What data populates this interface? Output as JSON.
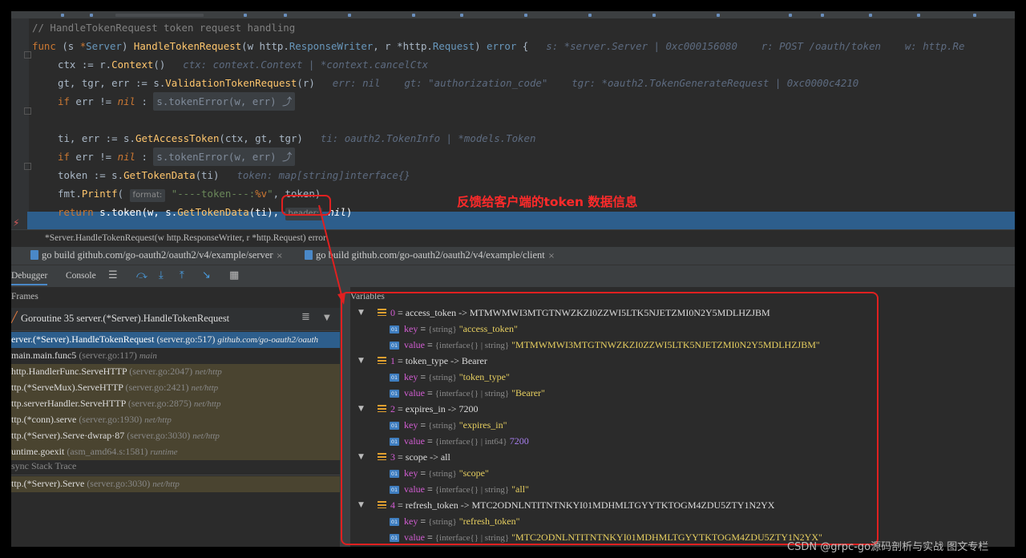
{
  "code": {
    "comment": "// HandleTokenRequest token request handling",
    "func_kw": "func",
    "func_recv": "(s ",
    "func_ptr": "*",
    "func_recv_type": "Server",
    "func_recv_close": ") ",
    "func_name": "HandleTokenRequest",
    "func_params_a": "(w http.",
    "func_params_type1": "ResponseWriter",
    "func_params_b": ", r *http.",
    "func_params_type2": "Request",
    "func_params_c": ") ",
    "func_ret": "error",
    "func_open": " {",
    "func_hint": "s: *server.Server | 0xc000156080    r: POST /oauth/token    w: http.Re",
    "l2_code": "ctx := r.",
    "l2_fn": "Context",
    "l2_rest": "()",
    "l2_hint": "ctx: context.Context | *context.cancelCtx",
    "l3_code": "gt, tgr, err := s.",
    "l3_fn": "ValidationTokenRequest",
    "l3_rest": "(r)",
    "l3_hint": "err: nil    gt: \"authorization_code\"    tgr: *oauth2.TokenGenerateRequest | 0xc0000c4210",
    "l4_kw": "if",
    "l4_cond": " err != ",
    "l4_nil": "nil",
    "l4_sep": " : ",
    "l4_fold": "s.tokenError(w, err) ⤴",
    "l6_code": "ti, err := s.",
    "l6_fn": "GetAccessToken",
    "l6_rest": "(ctx, gt, tgr)",
    "l6_hint": "ti: oauth2.TokenInfo | *models.Token",
    "l7_fold": "s.tokenError(w, err) ⤴",
    "l8_code": "token := s.",
    "l8_fn": "GetTokenData",
    "l8_rest": "(ti)",
    "l8_hint": "token: map[string]interface{}",
    "l9_code": "fmt.",
    "l9_fn": "Printf",
    "l9_open": "(",
    "l9_tag": "format:",
    "l9_str": "\"----token---:",
    "l9_verb": "%v",
    "l9_str_end": "\"",
    "l9_rest": ", token)",
    "l10_kw": "return",
    "l10_code": " s.token(w, s.",
    "l10_fn": "GetTokenData",
    "l10_rest": "(ti),",
    "l10_tag": "header:",
    "l10_nil": "nil",
    "l10_close": ")"
  },
  "annotation_text": "反馈给客户端的token 数据信息",
  "signature": "*Server.HandleTokenRequest(w http.ResponseWriter, r *http.Request) error",
  "run_tabs": [
    {
      "label": "go build github.com/go-oauth2/oauth2/v4/example/server",
      "close": "×"
    },
    {
      "label": "go build github.com/go-oauth2/oauth2/v4/example/client",
      "close": "×"
    }
  ],
  "debugger_tabs": {
    "debugger": "Debugger",
    "console": "Console"
  },
  "toolbar_icons": [
    "menu-icon",
    "step-over-icon",
    "step-into-icon",
    "step-out-icon",
    "run-to-cursor-icon",
    "evaluate-icon"
  ],
  "frames": {
    "title": "Frames",
    "goroutine": "Goroutine 35 server.(*Server).HandleTokenRequest",
    "items": [
      {
        "fn": "erver.(*Server).HandleTokenRequest",
        "loc": "(server.go:517)",
        "pkg": "github.com/go-oauth2/oauth"
      },
      {
        "fn": "main.main.func5",
        "loc": "(server.go:117)",
        "pkg": "main"
      },
      {
        "fn": "http.HandlerFunc.ServeHTTP",
        "loc": "(server.go:2047)",
        "pkg": "net/http"
      },
      {
        "fn": "ttp.(*ServeMux).ServeHTTP",
        "loc": "(server.go:2421)",
        "pkg": "net/http"
      },
      {
        "fn": "ttp.serverHandler.ServeHTTP",
        "loc": "(server.go:2875)",
        "pkg": "net/http"
      },
      {
        "fn": "ttp.(*conn).serve",
        "loc": "(server.go:1930)",
        "pkg": "net/http"
      },
      {
        "fn": "ttp.(*Server).Serve·dwrap·87",
        "loc": "(server.go:3030)",
        "pkg": "net/http"
      },
      {
        "fn": "untime.goexit",
        "loc": "(asm_amd64.s:1581)",
        "pkg": "runtime"
      }
    ],
    "async_label": "sync Stack Trace",
    "async_item": {
      "fn": "ttp.(*Server).Serve",
      "loc": "(server.go:3030)",
      "pkg": "net/http"
    }
  },
  "variables": {
    "title": "Variables",
    "entries": [
      {
        "index": "0",
        "summary": " = access_token -> MTMWMWI3MTGTNWZKZI0ZZWI5LTK5NJETZMI0N2Y5MDLHZJBM",
        "key": "\"access_token\"",
        "value": "\"MTMWMWI3MTGTNWZKZI0ZZWI5LTK5NJETZMI0N2Y5MDLHZJBM\"",
        "value_type": "{interface{} | string}"
      },
      {
        "index": "1",
        "summary": " = token_type -> Bearer",
        "key": "\"token_type\"",
        "value": "\"Bearer\"",
        "value_type": "{interface{} | string}"
      },
      {
        "index": "2",
        "summary": " = expires_in -> 7200",
        "key": "\"expires_in\"",
        "value": "7200",
        "value_type": "{interface{} | int64}"
      },
      {
        "index": "3",
        "summary": " = scope -> all",
        "key": "\"scope\"",
        "value": "\"all\"",
        "value_type": "{interface{} | string}"
      },
      {
        "index": "4",
        "summary": " = refresh_token -> MTC2ODNLNTITNTNKYI01MDHMLTGYYTKTOGM4ZDU5ZTY1N2YX",
        "key": "\"refresh_token\"",
        "value": "\"MTC2ODNLNTITNTNKYI01MDHMLTGYYTKTOGM4ZDU5ZTY1N2YX\"",
        "value_type": "{interface{} | string}"
      }
    ],
    "key_label": "key",
    "value_label": "value",
    "eq": " = ",
    "key_type": "{string}",
    "field_tag": "01"
  },
  "watermark": "CSDN @grpc-go源码剖析与实战 图文专栏",
  "colors": {
    "accent": "#2d5e8c",
    "annotation_red": "#e02020"
  }
}
